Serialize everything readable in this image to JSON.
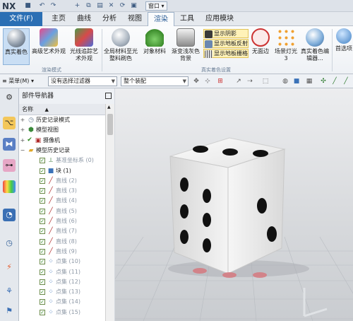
{
  "app": {
    "logo": "NX"
  },
  "quick_access": {
    "window_menu": "窗口"
  },
  "tabs": {
    "file": "文件(F)",
    "items": [
      "主页",
      "曲线",
      "分析",
      "视图",
      "渲染",
      "工具",
      "应用模块"
    ],
    "active_index": 4
  },
  "ribbon": {
    "buttons": [
      "真实着色",
      "高级艺术外观",
      "光线追踪艺术外观",
      "全局材料至光整料刷色",
      "对象材料",
      "渐变浅灰色背景",
      "无面边",
      "场景灯光 3",
      "真实着色编辑器...",
      "首选项"
    ],
    "small_buttons": [
      "显示阴影",
      "显示地板反射",
      "显示地板栅格"
    ],
    "groups": [
      "渲染模式",
      "真实着色设置"
    ]
  },
  "selection_bar": {
    "menu": "菜单(M)",
    "filter": "没有选择过滤器",
    "scope": "整个装配"
  },
  "navigator": {
    "title": "部件导航器",
    "column": "名称",
    "rows": [
      {
        "label": "历史记录模式",
        "depth": 0
      },
      {
        "label": "模型视图",
        "depth": 0
      },
      {
        "label": "摄像机",
        "depth": 0
      },
      {
        "label": "模型历史记录",
        "depth": 0
      },
      {
        "label": "基准坐标系 (0)",
        "depth": 1,
        "dim": true
      },
      {
        "label": "块 (1)",
        "depth": 1,
        "dim": false
      },
      {
        "label": "直线 (2)",
        "depth": 1,
        "dim": true
      },
      {
        "label": "直线 (3)",
        "depth": 1,
        "dim": true
      },
      {
        "label": "直线 (4)",
        "depth": 1,
        "dim": true
      },
      {
        "label": "直线 (5)",
        "depth": 1,
        "dim": true
      },
      {
        "label": "直线 (6)",
        "depth": 1,
        "dim": true
      },
      {
        "label": "直线 (7)",
        "depth": 1,
        "dim": true
      },
      {
        "label": "直线 (8)",
        "depth": 1,
        "dim": true
      },
      {
        "label": "直线 (9)",
        "depth": 1,
        "dim": true
      },
      {
        "label": "点集 (10)",
        "depth": 1,
        "dim": true
      },
      {
        "label": "点集 (11)",
        "depth": 1,
        "dim": true
      },
      {
        "label": "点集 (12)",
        "depth": 1,
        "dim": true
      },
      {
        "label": "点集 (13)",
        "depth": 1,
        "dim": true
      },
      {
        "label": "点集 (14)",
        "depth": 1,
        "dim": true
      },
      {
        "label": "点集 (15)",
        "depth": 1,
        "dim": true
      }
    ]
  },
  "colors": {
    "file_tab": "#2b6fb4",
    "accent": "#2b5d96",
    "pip_red": "#d7747a"
  }
}
